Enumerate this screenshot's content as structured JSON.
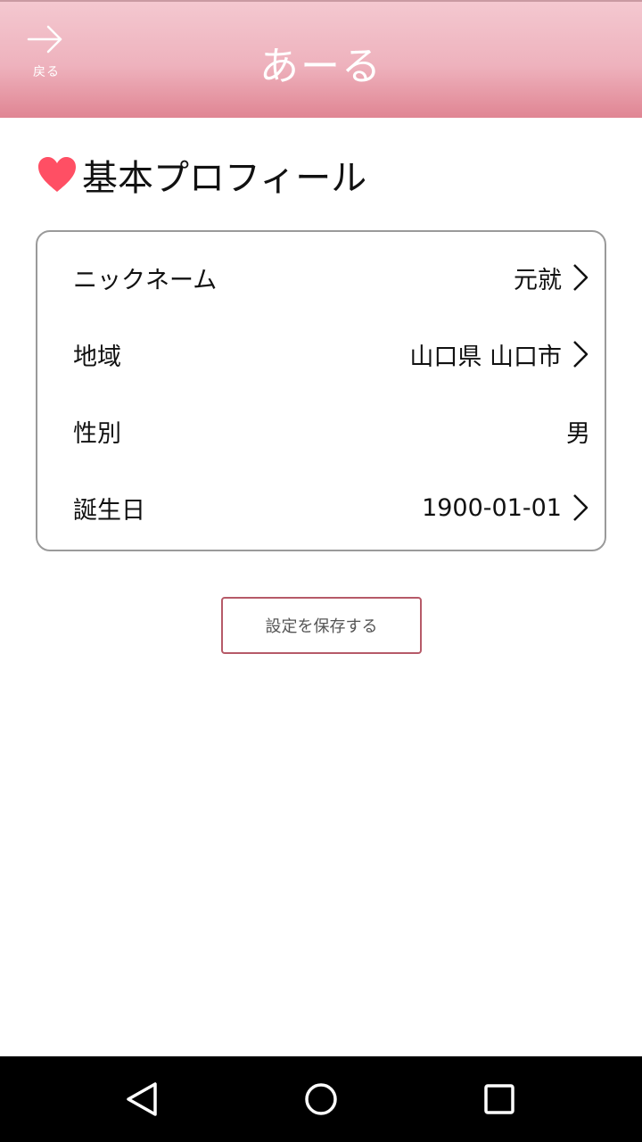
{
  "header": {
    "title": "あーる",
    "back_label": "戻る",
    "back_icon": "arrow-right-icon"
  },
  "section": {
    "title": "基本プロフィール",
    "icon": "heart-icon",
    "icon_color": "#ff4f64"
  },
  "profile": {
    "rows": [
      {
        "label": "ニックネーム",
        "value": "元就",
        "has_chevron": true
      },
      {
        "label": "地域",
        "value": "山口県 山口市",
        "has_chevron": true
      },
      {
        "label": "性別",
        "value": "男",
        "has_chevron": false
      },
      {
        "label": "誕生日",
        "value": "1900-01-01",
        "has_chevron": true
      }
    ]
  },
  "actions": {
    "save_label": "設定を保存する"
  },
  "colors": {
    "header_top": "#f4c8d0",
    "header_bottom": "#e08593",
    "save_border": "#b65a68",
    "card_border": "#9a9a9a"
  },
  "system_nav": {
    "back_icon": "triangle-back-icon",
    "home_icon": "circle-home-icon",
    "recents_icon": "square-recents-icon"
  }
}
